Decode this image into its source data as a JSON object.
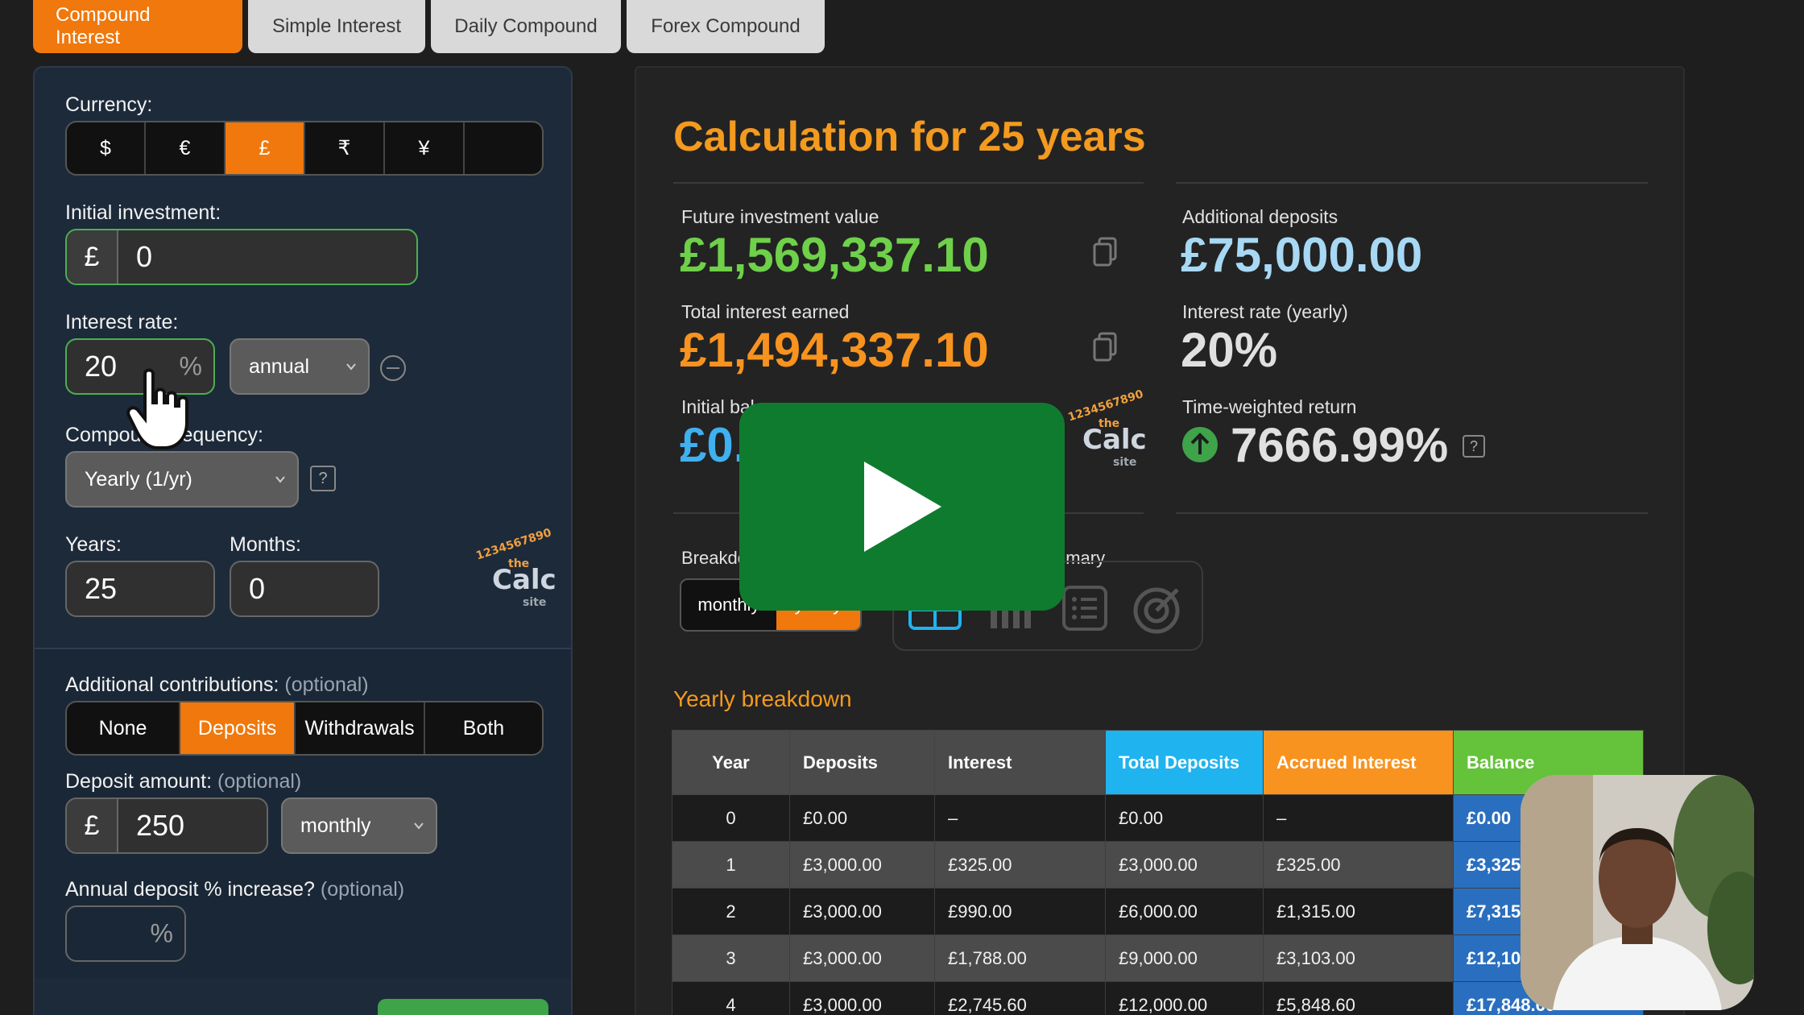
{
  "tabs": [
    {
      "label": "Compound Interest",
      "active": true
    },
    {
      "label": "Simple Interest",
      "active": false
    },
    {
      "label": "Daily Compound",
      "active": false
    },
    {
      "label": "Forex Compound",
      "active": false
    }
  ],
  "form": {
    "currency_label": "Currency:",
    "currencies": [
      "$",
      "€",
      "£",
      "₹",
      "¥",
      ""
    ],
    "selected_currency": "£",
    "initial_investment_label": "Initial investment:",
    "currency_symbol": "£",
    "initial_investment_value": "0",
    "interest_rate_label": "Interest rate:",
    "interest_rate_value": "20",
    "percent_symbol": "%",
    "interest_period": "annual",
    "compound_frequency_label": "Compound frequency:",
    "compound_frequency_value": "Yearly (1/yr)",
    "help_symbol": "?",
    "years_label": "Years:",
    "years_value": "25",
    "months_label": "Months:",
    "months_value": "0",
    "additional_contributions_label": "Additional contributions:",
    "optional_text": "(optional)",
    "contribution_options": [
      "None",
      "Deposits",
      "Withdrawals",
      "Both"
    ],
    "selected_contribution": "Deposits",
    "deposit_amount_label": "Deposit amount:",
    "deposit_amount_value": "250",
    "deposit_frequency": "monthly",
    "annual_increase_label": "Annual deposit % increase?",
    "annual_increase_value": ""
  },
  "logo": {
    "top_arc": "1234567890",
    "the": "the",
    "calc": "Calc",
    "site": "site"
  },
  "results": {
    "heading": "Calculation for 25 years",
    "future_value_label": "Future investment value",
    "future_value": "£1,569,337.10",
    "total_interest_label": "Total interest earned",
    "total_interest": "£1,494,337.10",
    "initial_balance_label": "Initial balance",
    "initial_balance": "£0.00",
    "additional_deposits_label": "Additional deposits",
    "additional_deposits": "£75,000.00",
    "interest_rate_yearly_label": "Interest rate (yearly)",
    "interest_rate_yearly": "20%",
    "twr_label": "Time-weighted return",
    "twr_value": "7666.99%",
    "breakdown_label": "Breakdown",
    "summary_label": "Summary",
    "breakdown_modes": [
      "monthly",
      "yearly"
    ],
    "selected_mode": "yearly",
    "view_icons": [
      "table-icon",
      "bar-chart-icon",
      "list-icon",
      "target-icon"
    ]
  },
  "table": {
    "title": "Yearly breakdown",
    "headers": [
      "Year",
      "Deposits",
      "Interest",
      "Total Deposits",
      "Accrued Interest",
      "Balance"
    ],
    "rows": [
      [
        "0",
        "£0.00",
        "–",
        "£0.00",
        "–",
        "£0.00"
      ],
      [
        "1",
        "£3,000.00",
        "£325.00",
        "£3,000.00",
        "£325.00",
        "£3,325.00"
      ],
      [
        "2",
        "£3,000.00",
        "£990.00",
        "£6,000.00",
        "£1,315.00",
        "£7,315.00"
      ],
      [
        "3",
        "£3,000.00",
        "£1,788.00",
        "£9,000.00",
        "£3,103.00",
        "£12,103.00"
      ],
      [
        "4",
        "£3,000.00",
        "£2,745.60",
        "£12,000.00",
        "£5,848.60",
        "£17,848.60"
      ]
    ]
  },
  "colors": {
    "accent": "#f0780c",
    "heading": "#f39a1f",
    "green": "#6fd04a",
    "blue": "#3fb0f0",
    "play_button": "#0f7b2f"
  }
}
